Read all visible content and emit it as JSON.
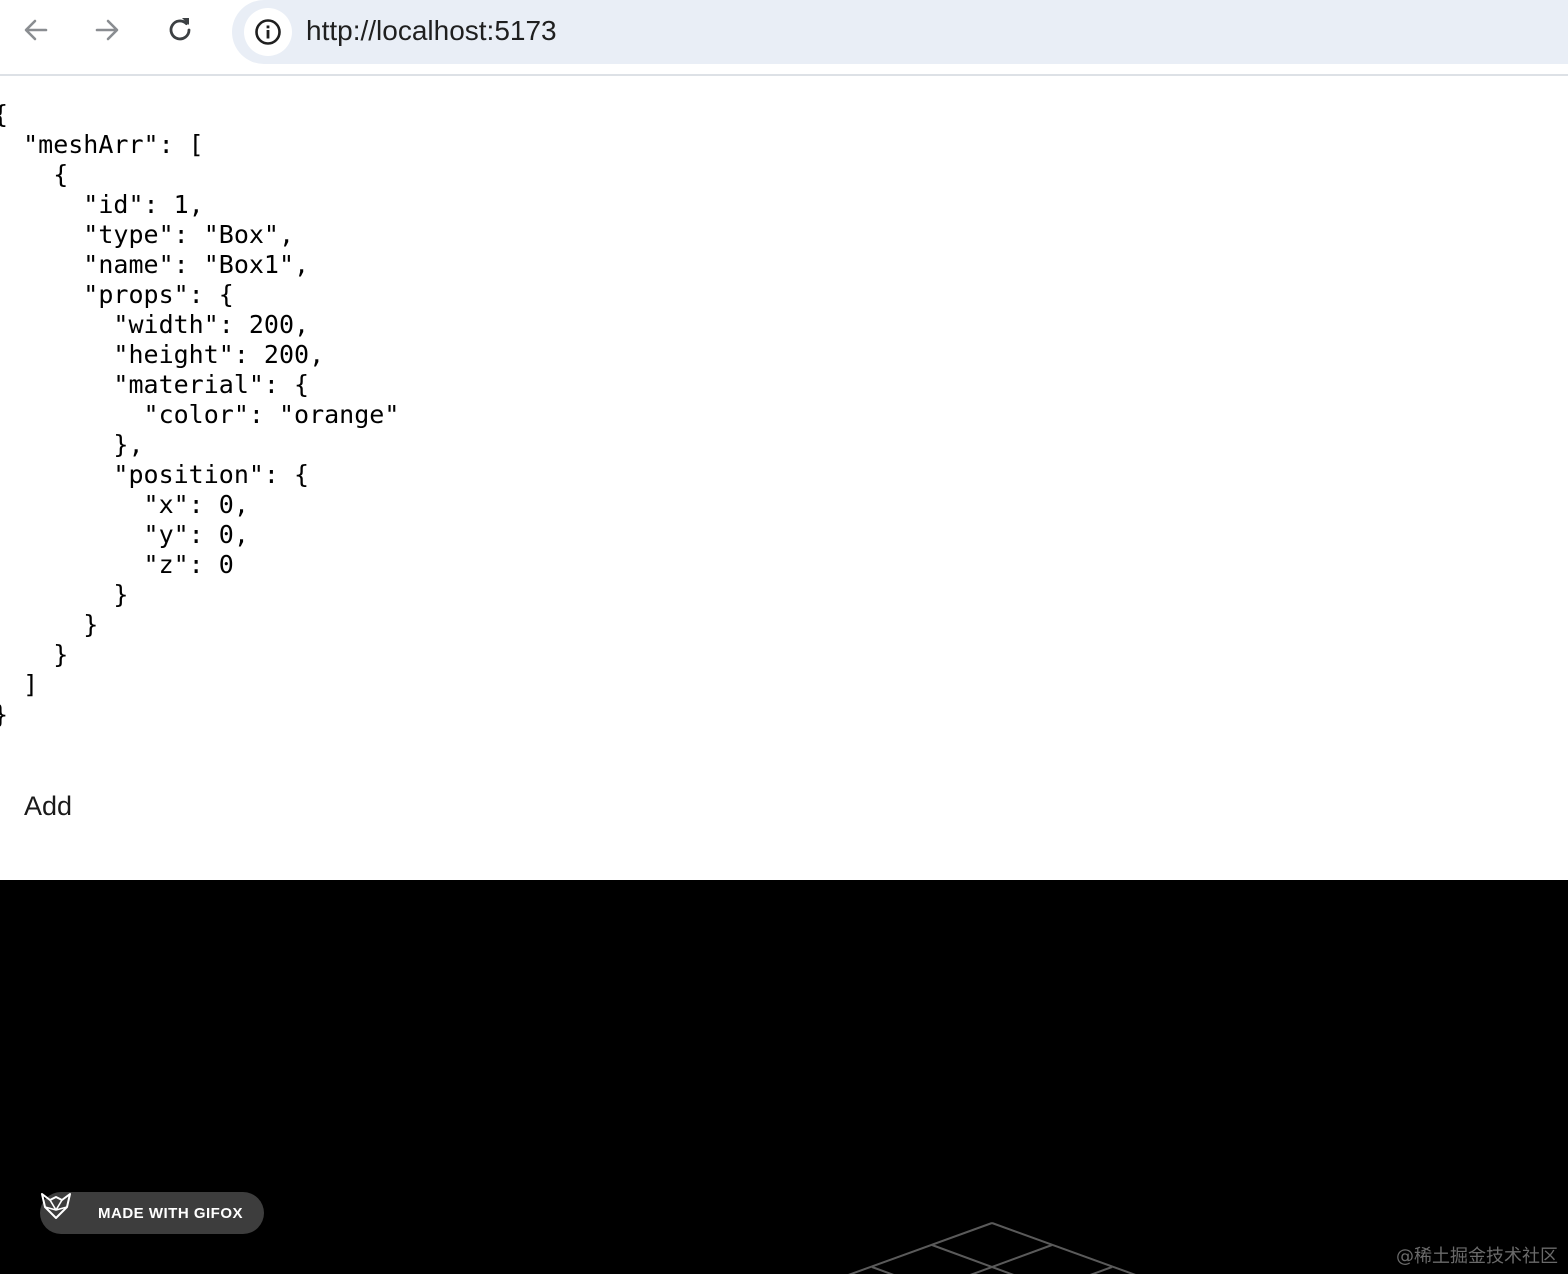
{
  "browser": {
    "url": "http://localhost:5173",
    "icons": {
      "back": "arrow-left-icon",
      "forward": "arrow-right-icon",
      "reload": "reload-icon",
      "site_info": "info-icon"
    }
  },
  "json_view": {
    "text": "{\n  \"meshArr\": [\n    {\n      \"id\": 1,\n      \"type\": \"Box\",\n      \"name\": \"Box1\",\n      \"props\": {\n        \"width\": 200,\n        \"height\": 200,\n        \"material\": {\n          \"color\": \"orange\"\n        },\n        \"position\": {\n          \"x\": 0,\n          \"y\": 0,\n          \"z\": 0\n        }\n      }\n    }\n  ]\n}"
  },
  "controls": {
    "add_label": "Add"
  },
  "overlay": {
    "gifox_label": "MADE WITH GIFOX",
    "watermark": "@稀土掘金技术社区"
  },
  "colors": {
    "canvas_background": "#000000",
    "grid_line": "#5a5a5a",
    "address_bar": "#e9eef6"
  }
}
